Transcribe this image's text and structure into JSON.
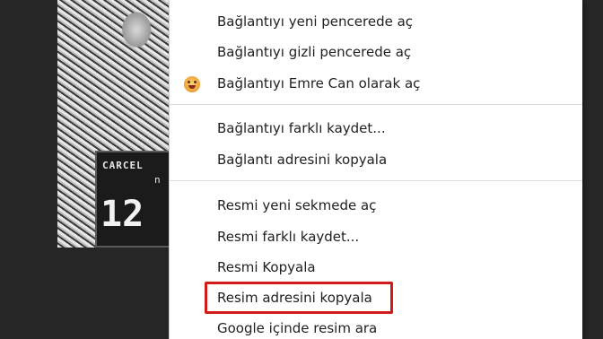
{
  "background_photo": {
    "board_text": "CARCEL",
    "board_small": "n",
    "board_number": "12"
  },
  "context_menu": {
    "items": [
      {
        "label": "Bağlantıyı yeni pencerede aç"
      },
      {
        "label": "Bağlantıyı gizli pencerede aç"
      },
      {
        "label": "Bağlantıyı Emre Can olarak aç",
        "icon": "profile-avatar-icon"
      },
      {
        "label": "Bağlantıyı farklı kaydet..."
      },
      {
        "label": "Bağlantı adresini kopyala"
      },
      {
        "label": "Resmi yeni sekmede aç"
      },
      {
        "label": "Resmi farklı kaydet..."
      },
      {
        "label": "Resmi Kopyala"
      },
      {
        "label": "Resim adresini kopyala",
        "highlighted": true
      },
      {
        "label": "Google içinde resim ara"
      }
    ]
  },
  "colors": {
    "highlight_border": "#d11a1a",
    "menu_background": "#ffffff",
    "page_background": "#262626"
  }
}
